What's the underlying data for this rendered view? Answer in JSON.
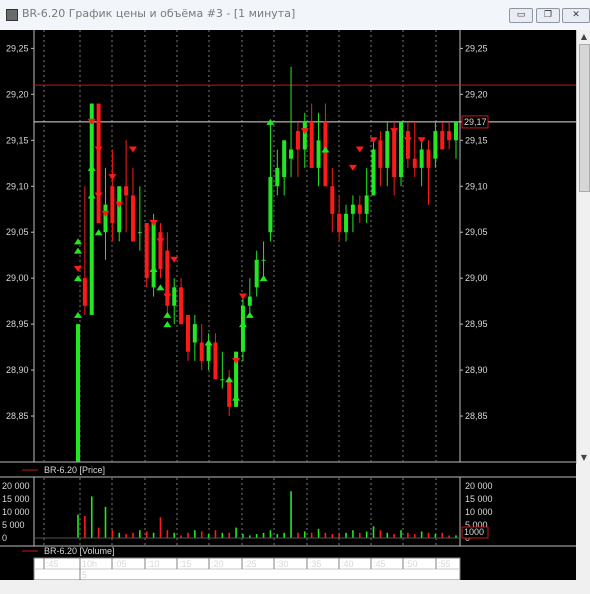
{
  "window": {
    "title": "BR-6.20 График цены и объёма #3 - [1 минута]",
    "buttons": {
      "minimize": "▭",
      "restore": "❐",
      "close": "✕"
    }
  },
  "price_axis": {
    "labels": [
      "29,25",
      "29,20",
      "29,15",
      "29,10",
      "29,05",
      "29,00",
      "28,95",
      "28,90",
      "28,85"
    ],
    "current_price": "29,17"
  },
  "price_legend": "BR-6.20 [Price]",
  "volume_axis": {
    "left_labels": [
      "20 000",
      "15 000",
      "10 000",
      "5 000",
      "0"
    ],
    "right_labels": [
      "20 000",
      "15 000",
      "10 000",
      "5 000",
      "0"
    ],
    "current_volume": "1000"
  },
  "volume_legend": "BR-6.20 [Volume]",
  "time_axis": {
    "labels": [
      ":45",
      "10h",
      ":05",
      ":10",
      ":15",
      ":20",
      ":25",
      ":30",
      ":35",
      ":40",
      ":45",
      ":50",
      ":55"
    ],
    "sub_label": "5"
  },
  "colors": {
    "up": "#22e822",
    "down": "#ff1a1a",
    "background": "#000000",
    "grid": "#7a7a7a"
  },
  "chart_data": {
    "type": "candlestick",
    "y_unit": "price",
    "candles": [
      {
        "o": 28.8,
        "h": 28.95,
        "l": 28.8,
        "c": 28.95
      },
      {
        "o": 29.0,
        "h": 29.1,
        "l": 28.96,
        "c": 28.97
      },
      {
        "o": 28.96,
        "h": 29.19,
        "l": 28.96,
        "c": 29.19
      },
      {
        "o": 29.19,
        "h": 29.18,
        "l": 29.06,
        "c": 29.06
      },
      {
        "o": 29.05,
        "h": 29.12,
        "l": 29.02,
        "c": 29.08
      },
      {
        "o": 29.1,
        "h": 29.14,
        "l": 29.04,
        "c": 29.06
      },
      {
        "o": 29.05,
        "h": 29.1,
        "l": 29.04,
        "c": 29.1
      },
      {
        "o": 29.1,
        "h": 29.15,
        "l": 29.05,
        "c": 29.09
      },
      {
        "o": 29.09,
        "h": 29.12,
        "l": 29.04,
        "c": 29.04
      },
      {
        "o": 29.05,
        "h": 29.1,
        "l": 29.03,
        "c": 29.05
      },
      {
        "o": 29.06,
        "h": 29.06,
        "l": 28.99,
        "c": 29.0
      },
      {
        "o": 28.99,
        "h": 29.07,
        "l": 28.98,
        "c": 29.06
      },
      {
        "o": 29.05,
        "h": 29.06,
        "l": 29.0,
        "c": 29.01
      },
      {
        "o": 29.03,
        "h": 29.05,
        "l": 28.96,
        "c": 28.97
      },
      {
        "o": 28.97,
        "h": 29.0,
        "l": 28.95,
        "c": 28.99
      },
      {
        "o": 28.99,
        "h": 29.0,
        "l": 28.95,
        "c": 28.95
      },
      {
        "o": 28.96,
        "h": 28.96,
        "l": 28.91,
        "c": 28.92
      },
      {
        "o": 28.93,
        "h": 28.96,
        "l": 28.91,
        "c": 28.95
      },
      {
        "o": 28.93,
        "h": 28.95,
        "l": 28.9,
        "c": 28.91
      },
      {
        "o": 28.91,
        "h": 28.94,
        "l": 28.9,
        "c": 28.93
      },
      {
        "o": 28.93,
        "h": 28.94,
        "l": 28.89,
        "c": 28.89
      },
      {
        "o": 28.89,
        "h": 28.92,
        "l": 28.88,
        "c": 28.89
      },
      {
        "o": 28.89,
        "h": 28.9,
        "l": 28.85,
        "c": 28.86
      },
      {
        "o": 28.86,
        "h": 28.92,
        "l": 28.86,
        "c": 28.92
      },
      {
        "o": 28.92,
        "h": 28.98,
        "l": 28.91,
        "c": 28.97
      },
      {
        "o": 28.97,
        "h": 29.0,
        "l": 28.96,
        "c": 28.98
      },
      {
        "o": 28.99,
        "h": 29.03,
        "l": 28.98,
        "c": 29.02
      },
      {
        "o": 29.02,
        "h": 29.04,
        "l": 29.0,
        "c": 29.02
      },
      {
        "o": 29.05,
        "h": 29.17,
        "l": 29.04,
        "c": 29.11
      },
      {
        "o": 29.1,
        "h": 29.14,
        "l": 29.09,
        "c": 29.12
      },
      {
        "o": 29.11,
        "h": 29.15,
        "l": 29.09,
        "c": 29.15
      },
      {
        "o": 29.13,
        "h": 29.23,
        "l": 29.11,
        "c": 29.14
      },
      {
        "o": 29.16,
        "h": 29.17,
        "l": 29.11,
        "c": 29.14
      },
      {
        "o": 29.14,
        "h": 29.18,
        "l": 29.12,
        "c": 29.17
      },
      {
        "o": 29.17,
        "h": 29.19,
        "l": 29.12,
        "c": 29.12
      },
      {
        "o": 29.12,
        "h": 29.18,
        "l": 29.1,
        "c": 29.15
      },
      {
        "o": 29.17,
        "h": 29.19,
        "l": 29.1,
        "c": 29.1
      },
      {
        "o": 29.1,
        "h": 29.12,
        "l": 29.05,
        "c": 29.07
      },
      {
        "o": 29.07,
        "h": 29.09,
        "l": 29.04,
        "c": 29.05
      },
      {
        "o": 29.05,
        "h": 29.08,
        "l": 29.04,
        "c": 29.07
      },
      {
        "o": 29.07,
        "h": 29.09,
        "l": 29.05,
        "c": 29.08
      },
      {
        "o": 29.08,
        "h": 29.09,
        "l": 29.06,
        "c": 29.07
      },
      {
        "o": 29.07,
        "h": 29.12,
        "l": 29.06,
        "c": 29.09
      },
      {
        "o": 29.09,
        "h": 29.15,
        "l": 29.09,
        "c": 29.14
      },
      {
        "o": 29.15,
        "h": 29.16,
        "l": 29.1,
        "c": 29.12
      },
      {
        "o": 29.12,
        "h": 29.17,
        "l": 29.1,
        "c": 29.16
      },
      {
        "o": 29.16,
        "h": 29.17,
        "l": 29.09,
        "c": 29.11
      },
      {
        "o": 29.11,
        "h": 29.17,
        "l": 29.1,
        "c": 29.17
      },
      {
        "o": 29.16,
        "h": 29.17,
        "l": 29.12,
        "c": 29.13
      },
      {
        "o": 29.13,
        "h": 29.17,
        "l": 29.11,
        "c": 29.12
      },
      {
        "o": 29.12,
        "h": 29.15,
        "l": 29.1,
        "c": 29.14
      },
      {
        "o": 29.14,
        "h": 29.15,
        "l": 29.08,
        "c": 29.12
      },
      {
        "o": 29.13,
        "h": 29.17,
        "l": 29.12,
        "c": 29.16
      },
      {
        "o": 29.16,
        "h": 29.17,
        "l": 29.14,
        "c": 29.14
      },
      {
        "o": 29.16,
        "h": 29.17,
        "l": 29.14,
        "c": 29.15
      },
      {
        "o": 29.15,
        "h": 29.17,
        "l": 29.13,
        "c": 29.17
      }
    ],
    "volumes": [
      9000,
      8500,
      16000,
      4000,
      12000,
      3000,
      2000,
      1500,
      2000,
      3000,
      2500,
      2000,
      8000,
      3000,
      2000,
      1000,
      2000,
      3000,
      2500,
      1500,
      3000,
      2000,
      2000,
      4000,
      1500,
      1000,
      1500,
      2000,
      3000,
      1500,
      2000,
      18000,
      2000,
      2500,
      2000,
      3500,
      2000,
      1500,
      2000,
      2000,
      3000,
      2000,
      2500,
      4500,
      3000,
      2000,
      1500,
      3000,
      2000,
      1500,
      2500,
      2000,
      1500,
      2000,
      1000,
      1000
    ],
    "levels": [
      29.21,
      29.17
    ],
    "arrows": {
      "up": [
        [
          0,
          29.04
        ],
        [
          0,
          29.03
        ],
        [
          0,
          29.0
        ],
        [
          0,
          28.96
        ],
        [
          2,
          29.12
        ],
        [
          2,
          29.09
        ],
        [
          3,
          29.05
        ],
        [
          11,
          29.01
        ],
        [
          12,
          28.99
        ],
        [
          13,
          28.96
        ],
        [
          13,
          28.95
        ],
        [
          19,
          28.93
        ],
        [
          22,
          28.89
        ],
        [
          23,
          28.87
        ],
        [
          24,
          28.95
        ],
        [
          25,
          28.96
        ],
        [
          27,
          29.0
        ],
        [
          28,
          29.17
        ],
        [
          36,
          29.14
        ]
      ],
      "down": [
        [
          0,
          29.01
        ],
        [
          2,
          29.17
        ],
        [
          3,
          29.14
        ],
        [
          3,
          29.09
        ],
        [
          4,
          29.07
        ],
        [
          5,
          29.11
        ],
        [
          6,
          29.08
        ],
        [
          8,
          29.14
        ],
        [
          11,
          29.06
        ],
        [
          12,
          29.04
        ],
        [
          13,
          28.98
        ],
        [
          14,
          29.02
        ],
        [
          23,
          28.91
        ],
        [
          24,
          28.98
        ],
        [
          33,
          29.16
        ],
        [
          40,
          29.12
        ],
        [
          41,
          29.14
        ],
        [
          43,
          29.15
        ],
        [
          46,
          29.16
        ],
        [
          48,
          29.15
        ],
        [
          50,
          29.15
        ]
      ]
    },
    "y_range": [
      28.8,
      29.27
    ],
    "volume_range": [
      0,
      20000
    ]
  }
}
